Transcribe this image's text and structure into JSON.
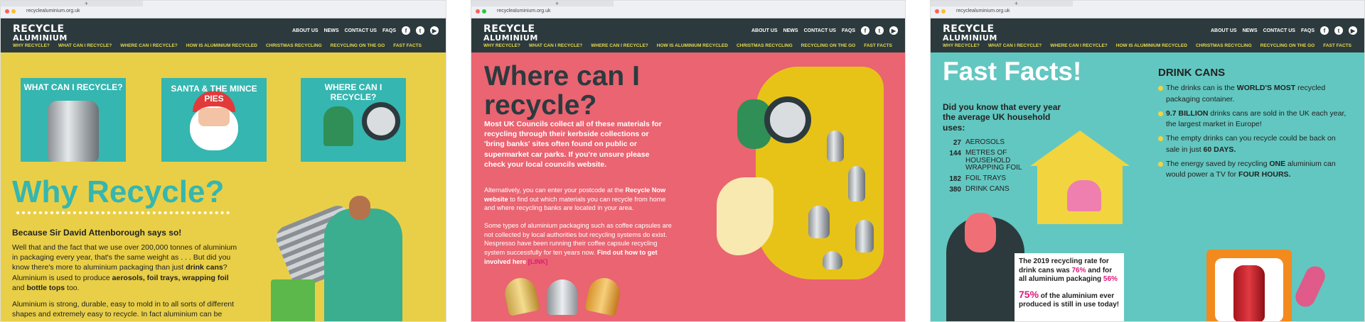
{
  "browser": {
    "url": "recyclealuminium.org.uk"
  },
  "site": {
    "logo_line1": "RECYCLE",
    "logo_line2": "ALUMINIUM",
    "top_nav": [
      "ABOUT US",
      "NEWS",
      "CONTACT US",
      "FAQS"
    ],
    "social_icons": [
      "facebook-icon",
      "twitter-icon",
      "youtube-icon"
    ],
    "sub_nav": [
      "WHY RECYCLE?",
      "WHAT CAN I RECYCLE?",
      "WHERE CAN I RECYCLE?",
      "HOW IS ALUMINIUM RECYCLED",
      "CHRISTMAS RECYCLING",
      "RECYCLING ON THE GO",
      "FAST FACTS"
    ]
  },
  "panel1": {
    "tiles": [
      "WHAT CAN I RECYCLE?",
      "SANTA & THE MINCE PIES",
      "WHERE CAN I RECYCLE?"
    ],
    "heading": "Why Recycle?",
    "subheading": "Because Sir David Attenborough says so!",
    "para1_a": "Well that and the fact that we use over 200,000 tonnes of aluminium in packaging every year, that's the same weight as . . . But did you know there's more to aluminium packaging than just ",
    "para1_b1": "drink cans",
    "para1_c": "? Aluminium is used to produce ",
    "para1_b2": "aerosols, foil trays, wrapping foil",
    "para1_d": " and ",
    "para1_b3": "bottle tops",
    "para1_e": " too.",
    "para2": "Aluminium is strong, durable, easy to mold in to all sorts of different shapes and extremely easy to recycle.  In fact aluminium can be"
  },
  "panel2": {
    "heading_l1": "Where can I",
    "heading_l2": "recycle?",
    "lead": "Most UK Councils collect all of these materials for recycling through their kerbside collections or 'bring banks' sites often found on public or supermarket car parks.  If you're unsure please check your local councils website.",
    "p1_a": "Alternatively, you can enter your postcode at the ",
    "p1_link": "Recycle Now website",
    "p1_b": " to find out which materials you can recycle from home and where recycling banks are located in your area.",
    "p2_a": "Some types of aluminium packaging such as coffee capsules are not collected by local authorities but recycling systems do exist.  Nespresso have been running their coffee capsule recycling system successfully for ten years now.  ",
    "p2_link": "Find out how to get involved here",
    "p2_tag": " [LINK]"
  },
  "panel3": {
    "heading": "Fast Facts!",
    "question": "Did you know that every year the average UK household uses:",
    "uses": [
      {
        "n": "27",
        "t": "AEROSOLS"
      },
      {
        "n": "144",
        "t": "METRES OF HOUSEHOLD WRAPPING FOIL"
      },
      {
        "n": "182",
        "t": "FOIL TRAYS"
      },
      {
        "n": "380",
        "t": "DRINK CANS"
      }
    ],
    "dc_title": "DRINK CANS",
    "facts": [
      {
        "a": "The drinks can is the ",
        "b": "WORLD'S MOST",
        "c": " recycled packaging container."
      },
      {
        "a": "",
        "b": "9.7 BILLION",
        "c": " drinks cans are sold in the UK each year, the largest market in Europe!"
      },
      {
        "a": "The empty drinks can you recycle could be back on sale in just ",
        "b": "60 DAYS.",
        "c": ""
      },
      {
        "a": "The energy saved by recycling ",
        "b": "ONE",
        "c": " aluminium can would power a TV for ",
        "d": "FOUR HOURS."
      }
    ],
    "stat_a": "The 2019 recycling rate for drink cans was ",
    "stat_p1": "76%",
    "stat_b": " and for all aluminium packaging ",
    "stat_p2": "56%",
    "stat_big": "75%",
    "stat_c": " of the aluminium ever produced is still in use today!"
  },
  "colors": {
    "nav": "#2c3a3e",
    "yellow": "#e9cf47",
    "teal": "#35b6b0",
    "coral": "#ea6471",
    "aqua": "#62c7c0",
    "pink": "#e2187c"
  }
}
